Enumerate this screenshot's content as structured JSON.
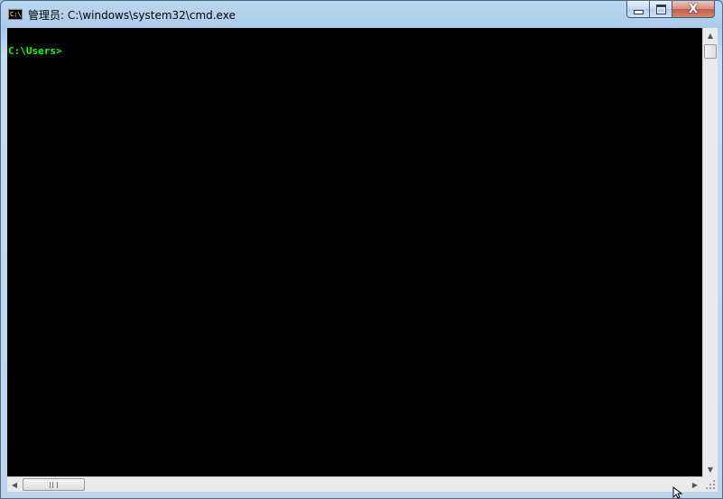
{
  "window": {
    "title": "管理员: C:\\windows\\system32\\cmd.exe",
    "icon": "console-app-icon",
    "icon_text": "C:\\_",
    "buttons": {
      "minimize": "minimize-icon",
      "maximize": "maximize-icon",
      "close_glyph": "X"
    }
  },
  "console": {
    "prompt": "C:\\Users>",
    "text_color": "#00ff00",
    "background": "#000000"
  },
  "scrollbars": {
    "vertical": {
      "up_arrow": "▲",
      "down_arrow": "▼"
    },
    "horizontal": {
      "left_arrow": "◀",
      "right_arrow": "▶"
    }
  }
}
